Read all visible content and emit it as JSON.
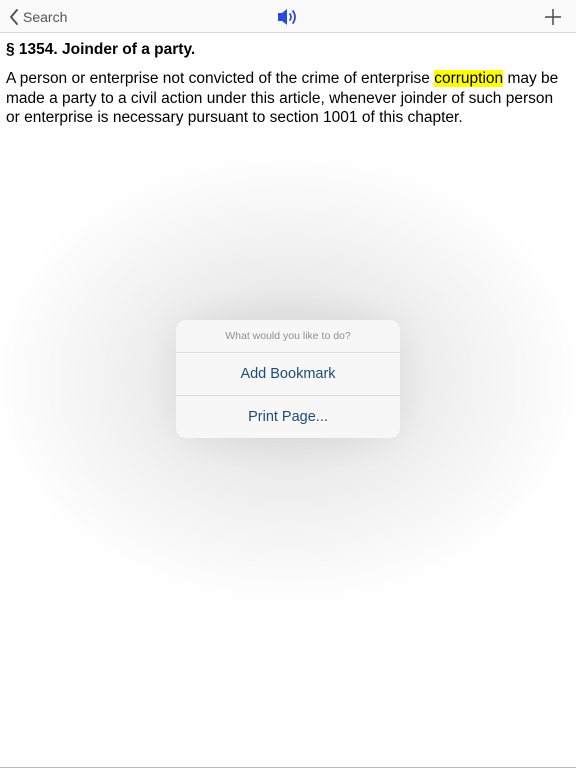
{
  "navbar": {
    "back_label": "Search",
    "back_icon": "chevron-left-icon",
    "speaker_icon": "speaker-icon",
    "add_icon": "plus-icon",
    "accent_color": "#2a4bd7"
  },
  "document": {
    "section_title": "§ 1354. Joinder of a party.",
    "body_before": "A person or enterprise not convicted of the crime of enterprise ",
    "highlighted_term": "corruption",
    "body_after": " may be made a party to a civil action under this article, whenever joinder of such person or enterprise is necessary pursuant to section 1001 of this chapter.",
    "highlight_color": "#ffff00"
  },
  "action_sheet": {
    "prompt": "What would you like to do?",
    "options": [
      {
        "label": "Add Bookmark"
      },
      {
        "label": "Print Page..."
      }
    ]
  }
}
